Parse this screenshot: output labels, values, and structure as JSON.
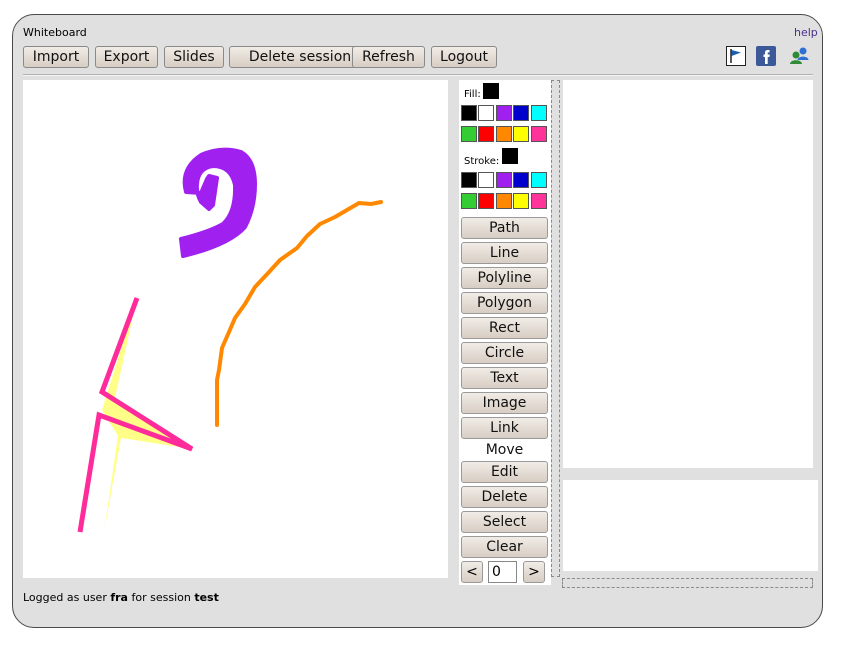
{
  "app": {
    "title": "Whiteboard",
    "help": "help"
  },
  "toolbar": {
    "buttons": [
      {
        "label": "Import"
      },
      {
        "label": "Export"
      },
      {
        "label": "Slides"
      },
      {
        "label": "Delete session"
      },
      {
        "label": "Refresh"
      },
      {
        "label": "Logout"
      }
    ]
  },
  "icons": [
    "flag-icon",
    "facebook-icon",
    "users-icon"
  ],
  "palette": {
    "fill_label": "Fill:",
    "stroke_label": "Stroke:",
    "fill_current": "#000000",
    "stroke_current": "#000000",
    "colors": [
      "#000000",
      "#ffffff",
      "#a020f0",
      "#0000cd",
      "#00ffff",
      "#33cc33",
      "#ff0000",
      "#ff8800",
      "#ffff00",
      "#ff3399"
    ]
  },
  "tools": {
    "modes": [
      "Path",
      "Line",
      "Polyline",
      "Polygon",
      "Rect",
      "Circle",
      "Text",
      "Image",
      "Link",
      "Move",
      "Edit",
      "Delete",
      "Select",
      "Clear"
    ],
    "active": "Move",
    "prev": "<",
    "next": ">",
    "page": "0"
  },
  "status": {
    "prefix": "Logged as user",
    "user": "fra",
    "middle": "for session",
    "session": "test"
  }
}
